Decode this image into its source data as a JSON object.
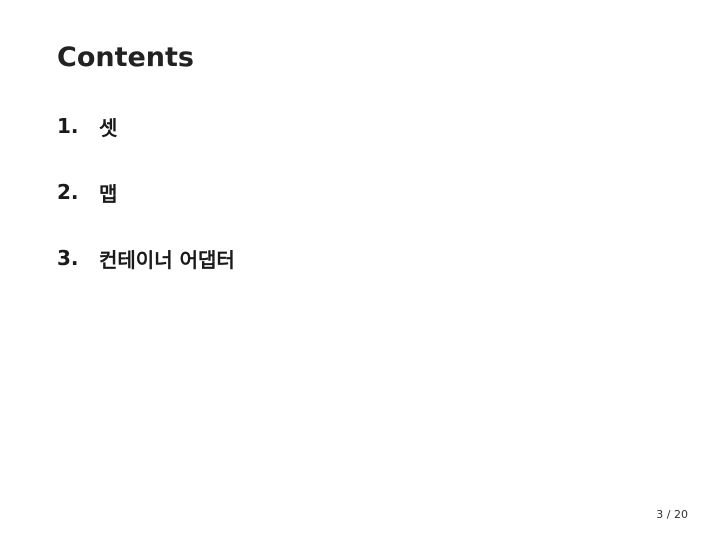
{
  "slide": {
    "title": "Contents",
    "items": [
      {
        "number": "1.",
        "label": "셋"
      },
      {
        "number": "2.",
        "label": "맵"
      },
      {
        "number": "3.",
        "label": "컨테이너 어댑터"
      }
    ],
    "page_number": "3 / 20"
  }
}
